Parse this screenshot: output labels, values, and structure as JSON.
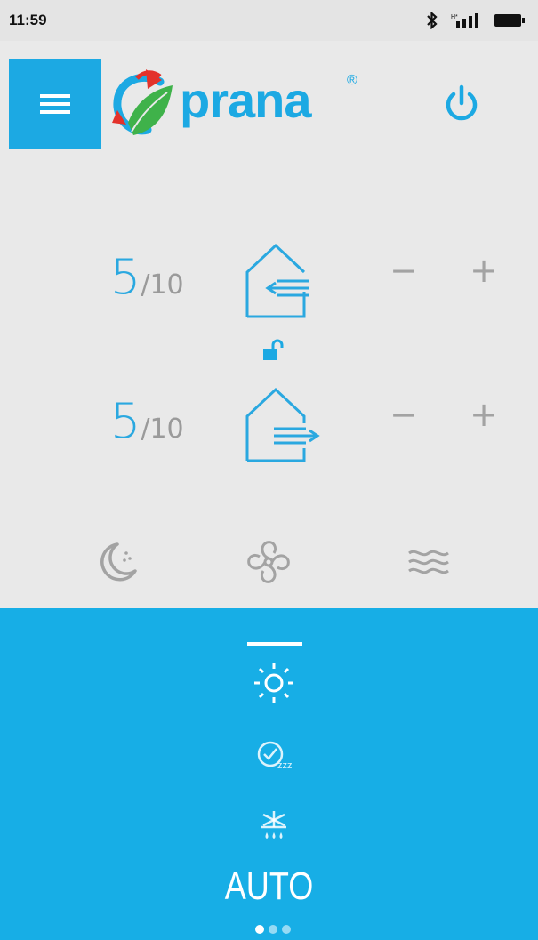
{
  "status_bar": {
    "time": "11:59",
    "icons": [
      "bluetooth-icon",
      "signal-icon",
      "battery-icon"
    ]
  },
  "header": {
    "menu_icon": "hamburger-icon",
    "logo_text": "prana",
    "logo_reg": "®",
    "power_icon": "power-icon"
  },
  "intake": {
    "level": "5",
    "max": "/10",
    "minus": "−",
    "plus": "+",
    "icon": "house-intake-icon"
  },
  "lock_icon": "unlock-icon",
  "exhaust": {
    "level": "5",
    "max": "/10",
    "minus": "−",
    "plus": "+",
    "icon": "house-exhaust-icon"
  },
  "modes": [
    "night-mode-icon",
    "fan-icon",
    "airflow-icon"
  ],
  "panel": {
    "icons": [
      "sun-icon",
      "timer-sleep-icon",
      "defrost-icon"
    ],
    "label": "AUTO",
    "pages": 3,
    "active_page": 1
  },
  "colors": {
    "accent": "#1ca9e3",
    "panel": "#17aee6",
    "background": "#e9e9e9",
    "muted": "#a3a3a3"
  }
}
